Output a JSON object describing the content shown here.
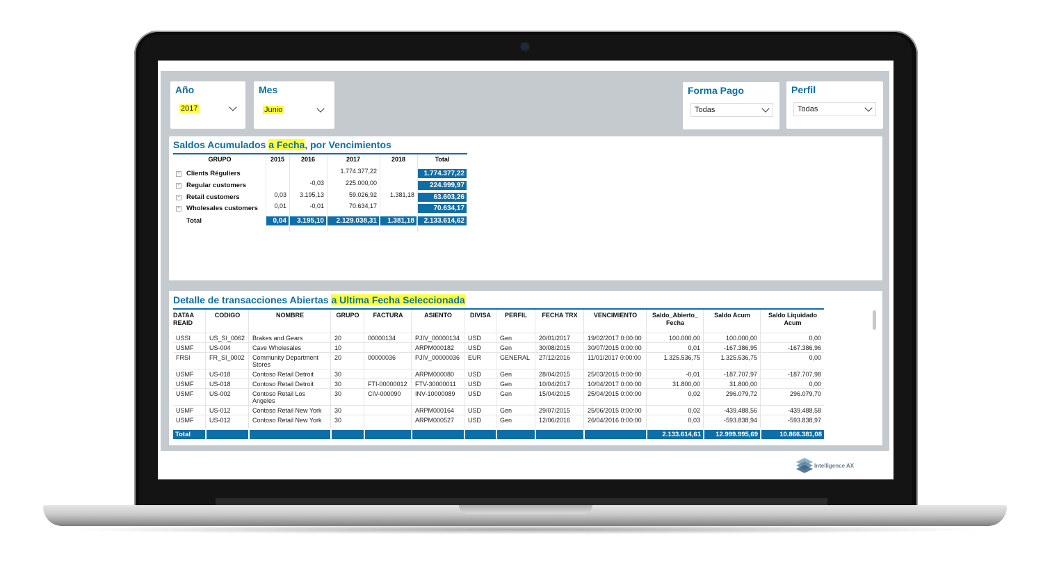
{
  "filters": {
    "anio": {
      "label": "Año",
      "value": "2017"
    },
    "mes": {
      "label": "Mes",
      "value": "Junio"
    },
    "forma_pago": {
      "label": "Forma Pago",
      "value": "Todas"
    },
    "perfil": {
      "label": "Perfil",
      "value": "Todas"
    }
  },
  "pivot": {
    "title_parts": [
      "Saldos Acumulados ",
      "a Fecha",
      ", por Vencimientos"
    ],
    "columns": [
      "GRUPO",
      "2015",
      "2016",
      "2017",
      "2018",
      "Total"
    ],
    "rows": [
      {
        "name": "Clients Réguliers",
        "c2015": "",
        "c2016": "",
        "c2017": "1.774.377,22",
        "c2018": "",
        "total": "1.774.377,22"
      },
      {
        "name": "Regular customers",
        "c2015": "",
        "c2016": "-0,03",
        "c2017": "225.000,00",
        "c2018": "",
        "total": "224.999,97"
      },
      {
        "name": "Retail customers",
        "c2015": "0,03",
        "c2016": "3.195,13",
        "c2017": "59.026,92",
        "c2018": "1.381,18",
        "total": "63.603,26"
      },
      {
        "name": "Wholesales customers",
        "c2015": "0,01",
        "c2016": "-0,01",
        "c2017": "70.634,17",
        "c2018": "",
        "total": "70.634,17"
      }
    ],
    "total": {
      "name": "Total",
      "c2015": "0,04",
      "c2016": "3.195,10",
      "c2017": "2.129.038,31",
      "c2018": "1.381,18",
      "total": "2.133.614,62"
    }
  },
  "detail": {
    "title_parts": [
      "Detalle de transacciones Abiertas ",
      "a Ultima Fecha Seleccionada"
    ],
    "columns": [
      "DATAA REAID",
      "CODIGO",
      "NOMBRE",
      "GRUPO",
      "FACTURA",
      "ASIENTO",
      "DIVISA",
      "PERFIL",
      "FECHA TRX",
      "VENCIMIENTO",
      "Saldo_Abierto_ Fecha",
      "Saldo Acum",
      "Saldo Liquidado Acum"
    ],
    "rows": [
      [
        "USSI",
        "US_SI_0062",
        "Brakes and Gears",
        "20",
        "00000134",
        "PJIV_00000134",
        "USD",
        "Gen",
        "20/01/2017",
        "19/02/2017 0:00:00",
        "100.000,00",
        "100.000,00",
        "0,00"
      ],
      [
        "USMF",
        "US-004",
        "Cave Wholesales",
        "10",
        "",
        "ARPM000182",
        "USD",
        "Gen",
        "30/08/2015",
        "30/07/2015 0:00:00",
        "0,01",
        "-167.386,95",
        "-167.386,96"
      ],
      [
        "FRSI",
        "FR_SI_0002",
        "Community Department Stores",
        "20",
        "00000036",
        "PJIV_00000036",
        "EUR",
        "GENERAL",
        "27/12/2016",
        "11/01/2017 0:00:00",
        "1.325.536,75",
        "1.325.536,75",
        "0,00"
      ],
      [
        "USMF",
        "US-018",
        "Contoso Retail Detroit",
        "30",
        "",
        "ARPM000080",
        "USD",
        "Gen",
        "28/04/2015",
        "25/03/2015 0:00:00",
        "-0,01",
        "-187.707,97",
        "-187.707,98"
      ],
      [
        "USMF",
        "US-018",
        "Contoso Retail Detroit",
        "30",
        "FTI-00000012",
        "FTV-30000011",
        "USD",
        "Gen",
        "10/04/2017",
        "10/04/2017 0:00:00",
        "31.800,00",
        "31.800,00",
        "0,00"
      ],
      [
        "USMF",
        "US-002",
        "Contoso Retail Los Angeles",
        "30",
        "CIV-000090",
        "INV-10000089",
        "USD",
        "Gen",
        "15/04/2015",
        "25/04/2015 0:00:00",
        "0,02",
        "296.079,72",
        "296.079,70"
      ],
      [
        "USMF",
        "US-012",
        "Contoso Retail New York",
        "30",
        "",
        "ARPM000164",
        "USD",
        "Gen",
        "29/07/2015",
        "25/06/2015 0:00:00",
        "0,02",
        "-439.488,56",
        "-439.488,58"
      ],
      [
        "USMF",
        "US-012",
        "Contoso Retail New York",
        "30",
        "",
        "ARPM000527",
        "USD",
        "Gen",
        "12/06/2016",
        "26/04/2016 0:00:00",
        "0,03",
        "-593.838,94",
        "-593.838,97"
      ]
    ],
    "total": {
      "label": "Total",
      "saldo_abierto": "2.133.614,61",
      "saldo_acum": "12.999.995,69",
      "saldo_liquidado": "10.866.381,08"
    }
  },
  "branding": {
    "logo_text": "Intelligence AX",
    "logo_icon": "stacked-layers-logo"
  },
  "colors": {
    "accent": "#0f6ea6",
    "highlight": "#ffff3a",
    "canvas": "#c5cace"
  }
}
